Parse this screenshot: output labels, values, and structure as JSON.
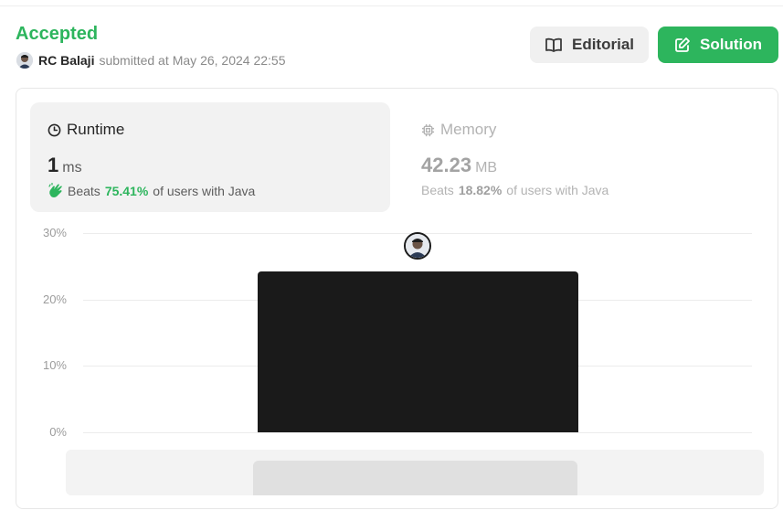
{
  "header": {
    "status": "Accepted",
    "user_name": "RC Balaji",
    "submitted_text": "submitted at",
    "submitted_date": "May 26, 2024 22:55",
    "editorial_label": "Editorial",
    "solution_label": "Solution"
  },
  "runtime": {
    "title": "Runtime",
    "value": "1",
    "unit": "ms",
    "beats_label": "Beats",
    "beats_pct": "75.41%",
    "beats_suffix": "of users with Java"
  },
  "memory": {
    "title": "Memory",
    "value": "42.23",
    "unit": "MB",
    "beats_label": "Beats",
    "beats_pct": "18.82%",
    "beats_suffix": "of users with Java"
  },
  "colors": {
    "accent_green": "#2db55d",
    "bar": "#1a1a1a"
  },
  "chart_data": {
    "type": "bar",
    "y_tick_labels": [
      "30%",
      "20%",
      "10%",
      "0%"
    ],
    "ylim": [
      0,
      30
    ],
    "values": [
      24.2
    ],
    "xlabel": "",
    "ylabel": ""
  }
}
